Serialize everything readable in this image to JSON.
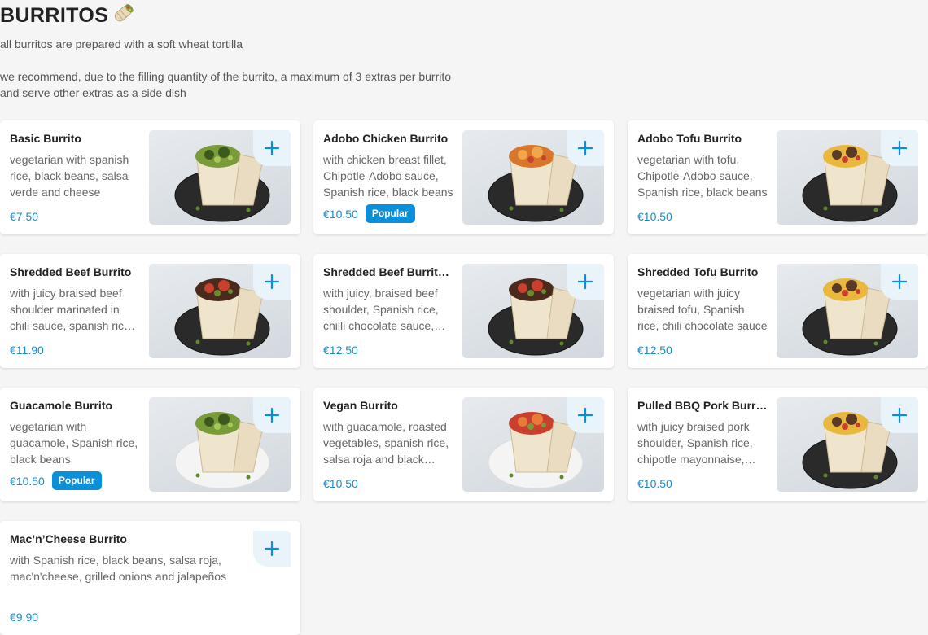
{
  "section": {
    "title": "BURRITOS",
    "intro_1": "all burritos are prepared with a soft wheat tortilla",
    "intro_2": "we recommend, due to the filling quantity of the burrito, a maximum of 3 extras per burrito",
    "intro_3": "and serve other extras as a side dish"
  },
  "colors": {
    "accent": "#0a90d9",
    "price": "#1b8cc6",
    "add_bg": "#e8f3fa"
  },
  "items": [
    {
      "name": "Basic Burrito",
      "desc": "vegetarian with spanish rice, black beans, salsa verde and cheese",
      "price": "€7.50",
      "badge": "",
      "plate": "dark",
      "filling": "green"
    },
    {
      "name": "Adobo Chicken Burrito",
      "desc": "with chicken breast fillet, Chipotle-Adobo sauce, Spanish rice, black beans",
      "price": "€10.50",
      "badge": "Popular",
      "plate": "dark",
      "filling": "chicken"
    },
    {
      "name": "Adobo Tofu Burrito",
      "desc": "vegetarian with tofu, Chipotle-Adobo sauce, Spanish rice, black beans",
      "price": "€10.50",
      "badge": "",
      "plate": "dark",
      "filling": "corn"
    },
    {
      "name": "Shredded Beef Burrito",
      "desc": "with juicy braised beef shoulder marinated in chili sauce, spanish rice, black beans",
      "price": "€11.90",
      "badge": "",
      "plate": "dark",
      "filling": "beef"
    },
    {
      "name": "Shredded Beef Burrito Deluxe",
      "desc": "with juicy, braised beef shoulder, Spanish rice, chilli chocolate sauce, black beans",
      "price": "€12.50",
      "badge": "",
      "plate": "dark",
      "filling": "beef"
    },
    {
      "name": "Shredded Tofu Burrito",
      "desc": "vegetarian with juicy braised tofu, Spanish rice, chili chocolate sauce",
      "price": "€12.50",
      "badge": "",
      "plate": "dark",
      "filling": "corn"
    },
    {
      "name": "Guacamole Burrito",
      "desc": "vegetarian with guacamole, Spanish rice, black beans",
      "price": "€10.50",
      "badge": "Popular",
      "plate": "white",
      "filling": "green"
    },
    {
      "name": "Vegan Burrito",
      "desc": "with guacamole, roasted vegetables, spanish rice, salsa roja and black beans",
      "price": "€10.50",
      "badge": "",
      "plate": "white",
      "filling": "veg"
    },
    {
      "name": "Pulled BBQ Pork Burrito",
      "desc": "with juicy braised pork shoulder, Spanish rice, chipotle mayonnaise, black beans",
      "price": "€10.50",
      "badge": "",
      "plate": "dark",
      "filling": "corn"
    },
    {
      "name": "Mac’n’Cheese Burrito",
      "desc": "with Spanish rice, black beans, salsa roja, mac'n'cheese, grilled onions and jalapeños",
      "price": "€9.90",
      "badge": "",
      "plate": "",
      "filling": ""
    }
  ]
}
